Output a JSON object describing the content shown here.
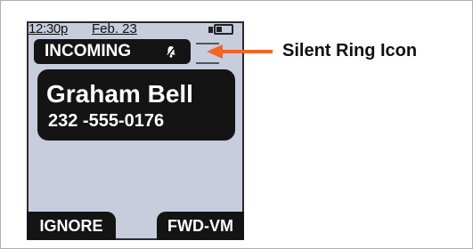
{
  "status_bar": {
    "time": "12:30p",
    "date": "Feb. 23",
    "battery_icon": "battery-icon"
  },
  "incoming_banner": {
    "label": "INCOMING",
    "icon": "silent-ring-icon"
  },
  "caller": {
    "name": "Graham Bell",
    "number": "232 -555-0176"
  },
  "softkeys": {
    "left_label": "IGNORE",
    "right_label": "FWD-VM"
  },
  "callout": {
    "label": "Silent Ring Icon",
    "arrow_color": "#f26522"
  },
  "colors": {
    "screen_background": "#c7cddd",
    "banner_background": "#141414"
  }
}
